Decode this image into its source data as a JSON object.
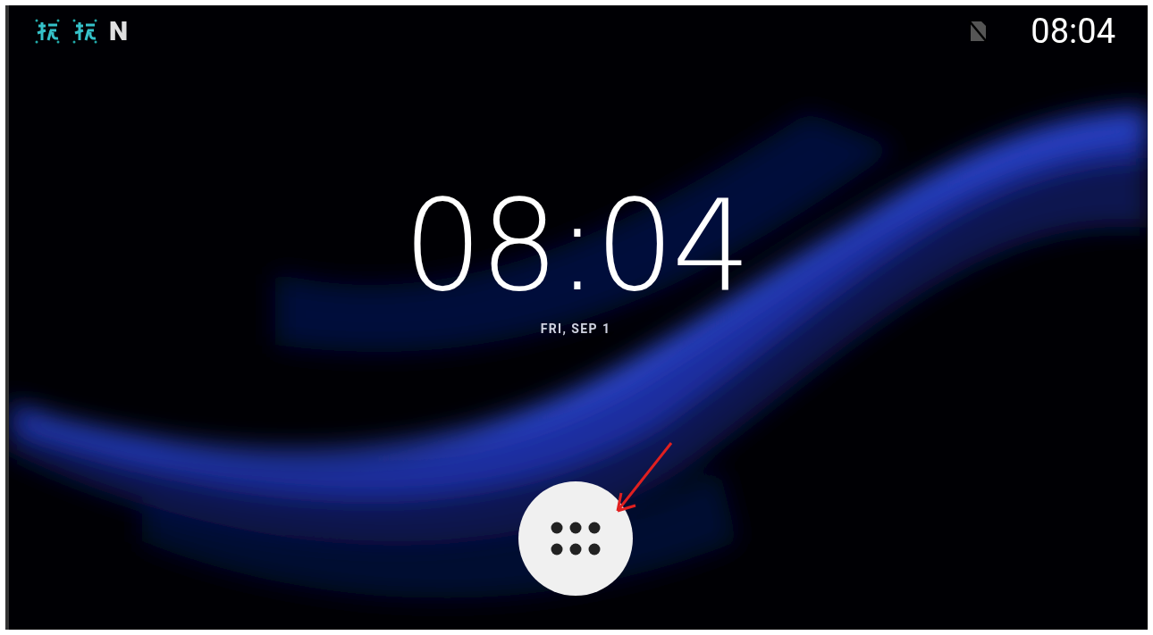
{
  "status_bar": {
    "notifications": [
      {
        "kind": "app"
      },
      {
        "kind": "app"
      },
      {
        "kind": "letter",
        "glyph": "N"
      }
    ],
    "no_sim": true,
    "time": "08:04"
  },
  "clock": {
    "time": "08:04",
    "date": "FRI, SEP 1"
  },
  "app_drawer_button": {
    "highlighted": true
  }
}
